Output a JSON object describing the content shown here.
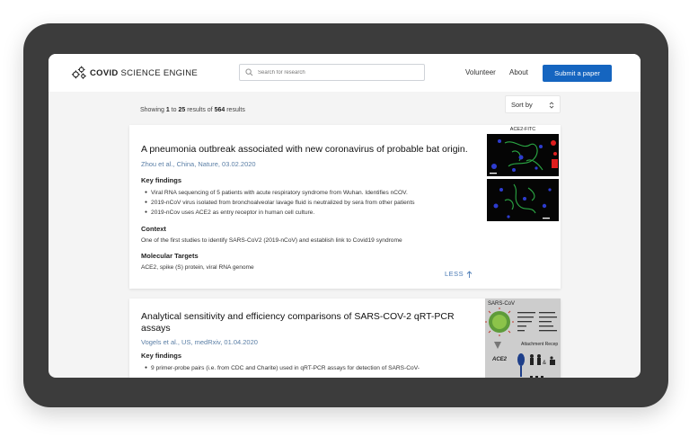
{
  "nav": {
    "logo_bold": "COVID",
    "logo_rest": "SCIENCE ENGINE",
    "search_placeholder": "Search for research",
    "links": [
      "Volunteer",
      "About"
    ],
    "submit_label": "Submit a paper",
    "accent_color": "#1565c0"
  },
  "results": {
    "prefix": "Showing",
    "from": "1",
    "to_word": "to",
    "to": "25",
    "mid": "results of",
    "total": "564",
    "suffix": "results"
  },
  "sort": {
    "label": "Sort by"
  },
  "papers": [
    {
      "title": "A pneumonia outbreak associated with new coronavirus of probable bat origin.",
      "authors": "Zhou et al., China, Nature, 03.02.2020",
      "key_findings_label": "Key findings",
      "findings": [
        "Viral RNA sequencing of 5 patients with acute respiratory syndrome from Wuhan. Identifies nCOV.",
        "2019-nCoV virus isolated from bronchoalveolar lavage fluid is neutralized by sera from other patients",
        "2019-nCov uses ACE2 as entry receptor in human cell culture."
      ],
      "context_label": "Context",
      "context": "One of the first studies to identify SARS-CoV2 (2019-nCoV) and establish link to Covid19 syndrome",
      "targets_label": "Molecular Targets",
      "targets": "ACE2, spike (S) protein, viral RNA genome",
      "less_label": "LESS",
      "figure_label": "ACE2-FITC"
    },
    {
      "title": "Analytical sensitivity and efficiency comparisons of SARS-COV-2 qRT-PCR assays",
      "authors": "Vogels et al., US, medRxiv, 01.04.2020",
      "key_findings_label": "Key findings",
      "findings": [
        "9 primer-probe pairs (i.e. from CDC and Charite) used in qRT-PCR assays for detection of SARS-CoV-"
      ],
      "figure_label": "SARS-CoV",
      "figure_sublabel": "Attachment Recep",
      "figure_receptor": "ACE2"
    }
  ]
}
